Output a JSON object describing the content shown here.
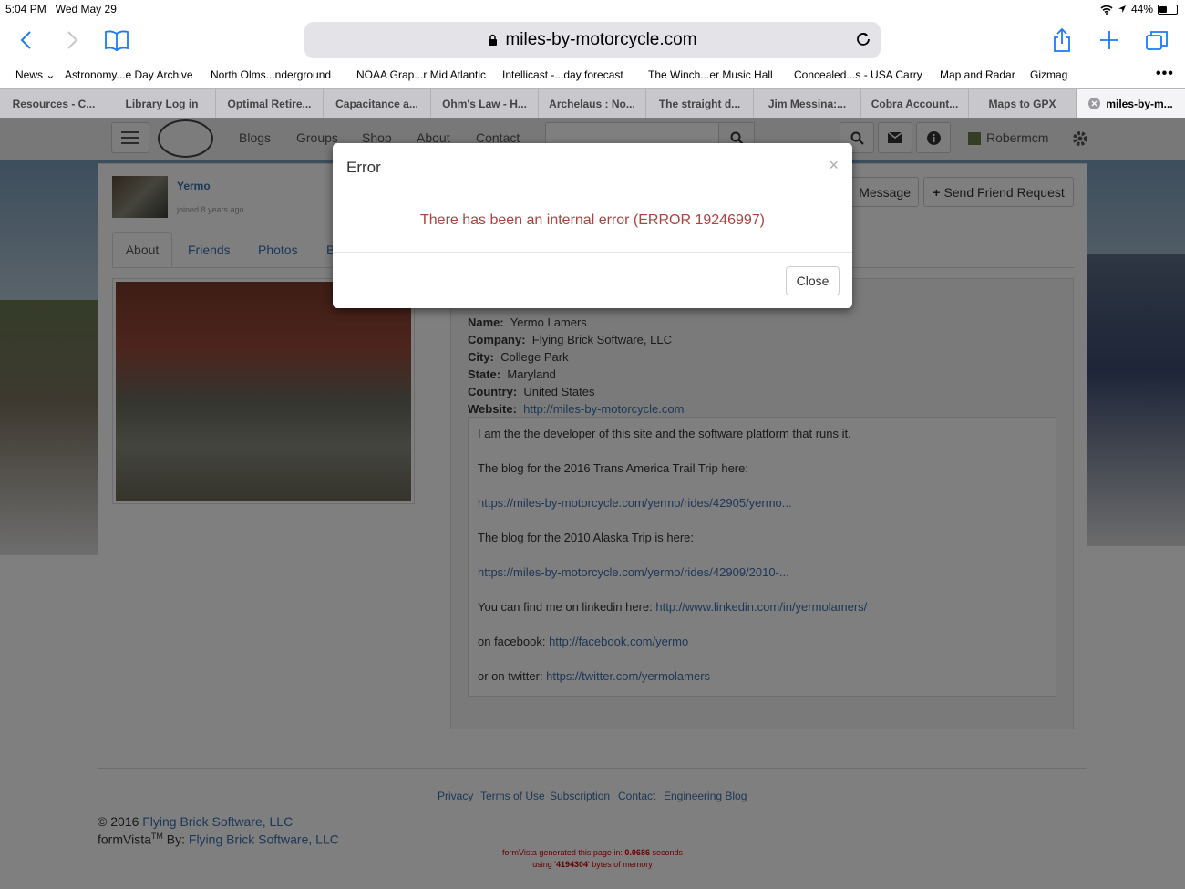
{
  "status": {
    "time": "5:04 PM",
    "date": "Wed May 29",
    "battery": "44%",
    "battery_level": 0.44
  },
  "browser": {
    "url": "miles-by-motorcycle.com",
    "favorites": [
      {
        "label": "News ⌄"
      },
      {
        "label": "Astronomy...e Day Archive"
      },
      {
        "label": "North Olms...nderground"
      },
      {
        "label": "NOAA Grap...r Mid Atlantic"
      },
      {
        "label": "Intellicast -...day forecast"
      },
      {
        "label": "The Winch...er Music Hall"
      },
      {
        "label": "Concealed...s - USA Carry"
      },
      {
        "label": "Map and Radar"
      },
      {
        "label": "Gizmag"
      }
    ],
    "tabs": [
      {
        "label": "Resources - C..."
      },
      {
        "label": "Library Log in"
      },
      {
        "label": "Optimal Retire..."
      },
      {
        "label": "Capacitance a..."
      },
      {
        "label": "Ohm's Law - H..."
      },
      {
        "label": "Archelaus : No..."
      },
      {
        "label": "The straight d..."
      },
      {
        "label": "Jim Messina:..."
      },
      {
        "label": "Cobra Account..."
      },
      {
        "label": "Maps to GPX"
      },
      {
        "label": "miles-by-m..."
      }
    ]
  },
  "site": {
    "nav": {
      "blogs": "Blogs",
      "groups": "Groups",
      "shop": "Shop",
      "about": "About",
      "contact": "Contact",
      "user": "Robermcm"
    },
    "profile": {
      "name": "Yermo",
      "joined": "joined 8 years ago",
      "tabs": {
        "about": "About",
        "friends": "Friends",
        "photos": "Photos",
        "b": "B"
      },
      "message_btn": "Message",
      "friend_btn": "Send Friend Request",
      "fields": {
        "name_label": "Name:",
        "name": "Yermo Lamers",
        "company_label": "Company:",
        "company": "Flying Brick Software, LLC",
        "city_label": "City:",
        "city": "College Park",
        "state_label": "State:",
        "state": "Maryland",
        "country_label": "Country:",
        "country": "United States",
        "website_label": "Website:",
        "website": "http://miles-by-motorcycle.com"
      },
      "bio": {
        "p1": "I am the the developer of this site and the software platform that runs it.",
        "p2": "The blog for the 2016 Trans America Trail Trip here:",
        "link1": "https://miles-by-motorcycle.com/yermo/rides/42905/yermo...",
        "p3": "The blog for the 2010 Alaska Trip is here:",
        "link2": "https://miles-by-motorcycle.com/yermo/rides/42909/2010-...",
        "p4": "You can find me on linkedin here: ",
        "link3": "http://www.linkedin.com/in/yermolamers/",
        "p5": "on facebook: ",
        "link4": "http://facebook.com/yermo",
        "p6": "or on twitter: ",
        "link5": "https://twitter.com/yermolamers"
      }
    },
    "footer": {
      "links": {
        "privacy": "Privacy",
        "terms": "Terms of Use",
        "subscription": "Subscription",
        "contact": "Contact",
        "engineering": "Engineering Blog"
      },
      "copyright_prefix": "© 2016 ",
      "copyright_link": "Flying Brick Software, LLC",
      "formvista_prefix": "formVista",
      "tm": "TM",
      "by": " By: ",
      "formvista_link": "Flying Brick Software, LLC",
      "gen1_prefix": "formVista generated this page in: ",
      "gen1_value": "0.0686",
      "gen1_suffix": " seconds",
      "gen2_prefix": "using '",
      "gen2_value": "4194304",
      "gen2_suffix": "' bytes of memory"
    }
  },
  "modal": {
    "title": "Error",
    "close_x": "×",
    "message": "There has been an internal error (ERROR 19246997)",
    "close_button": "Close"
  }
}
